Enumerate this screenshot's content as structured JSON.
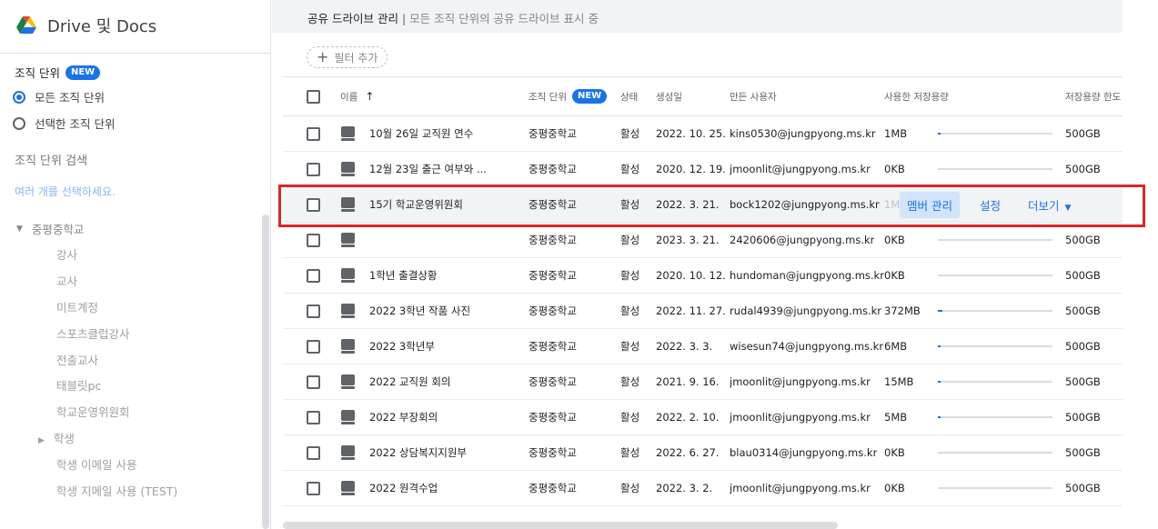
{
  "app": {
    "title": "Drive 및 Docs"
  },
  "sidebar": {
    "ou_heading": "조직 단위",
    "new_badge": "NEW",
    "options": [
      {
        "label": "모든 조직 단위",
        "selected": true
      },
      {
        "label": "선택한 조직 단위",
        "selected": false
      }
    ],
    "search_placeholder": "조직 단위 검색",
    "hint": "여러 개를 선택하세요.",
    "tree_root": "중평중학교",
    "tree_items": [
      {
        "label": "강사",
        "has_caret": false
      },
      {
        "label": "교사",
        "has_caret": false
      },
      {
        "label": "미트계정",
        "has_caret": false
      },
      {
        "label": "스포츠클럽강사",
        "has_caret": false
      },
      {
        "label": "전출교사",
        "has_caret": false
      },
      {
        "label": "태블릿pc",
        "has_caret": false
      },
      {
        "label": "학교운영위원회",
        "has_caret": false
      },
      {
        "label": "학생",
        "has_caret": true
      },
      {
        "label": "학생 이메일 사용",
        "has_caret": false
      },
      {
        "label": "학생 지메일 사용 (TEST)",
        "has_caret": false
      }
    ]
  },
  "header": {
    "title": "공유 드라이브 관리",
    "separator": "|",
    "subtitle": "모든 조직 단위의 공유 드라이브 표시 중"
  },
  "filter": {
    "label": "필터 추가"
  },
  "columns": {
    "name": "이름",
    "org_unit": "조직 단위",
    "org_unit_badge": "NEW",
    "status": "상태",
    "created": "생성일",
    "creator": "만든 사용자",
    "storage_used": "사용한 저장용량",
    "storage_limit": "저장용량 한도"
  },
  "row_actions": {
    "manage_members": "멤버 관리",
    "settings": "설정",
    "more": "더보기"
  },
  "rows": [
    {
      "name": "10월 26일 교직원 연수",
      "org": "중평중학교",
      "status": "활성",
      "created": "2022. 10. 25.",
      "creator": "kins0530@jungpyong.ms.kr",
      "used": "1MB",
      "usage": 0.02,
      "limit": "500GB"
    },
    {
      "name": "12월 23일 출근 여부와 ...",
      "org": "중평중학교",
      "status": "활성",
      "created": "2020. 12. 19.",
      "creator": "jmoonlit@jungpyong.ms.kr",
      "used": "0KB",
      "usage": 0,
      "limit": "500GB"
    },
    {
      "name": "15기 학교운영위원회",
      "org": "중평중학교",
      "status": "활성",
      "created": "2022. 3. 21.",
      "creator": "bock1202@jungpyong.ms.kr",
      "used": "1M",
      "usage": 0,
      "limit": "",
      "selected": true
    },
    {
      "name": "",
      "org": "중평중학교",
      "status": "활성",
      "created": "2023. 3. 21.",
      "creator": "2420606@jungpyong.ms.kr",
      "used": "0KB",
      "usage": 0,
      "limit": "500GB"
    },
    {
      "name": "1학년 출결상황",
      "org": "중평중학교",
      "status": "활성",
      "created": "2020. 10. 12.",
      "creator": "hundoman@jungpyong.ms.kr",
      "used": "0KB",
      "usage": 0,
      "limit": "500GB"
    },
    {
      "name": "2022 3학년 작품 사진",
      "org": "중평중학교",
      "status": "활성",
      "created": "2022. 11. 27.",
      "creator": "rudal4939@jungpyong.ms.kr",
      "used": "372MB",
      "usage": 0.04,
      "limit": "500GB"
    },
    {
      "name": "2022 3학년부",
      "org": "중평중학교",
      "status": "활성",
      "created": "2022. 3. 3.",
      "creator": "wisesun74@jungpyong.ms.kr",
      "used": "6MB",
      "usage": 0.02,
      "limit": "500GB"
    },
    {
      "name": "2022 교직원 회의",
      "org": "중평중학교",
      "status": "활성",
      "created": "2021. 9. 16.",
      "creator": "jmoonlit@jungpyong.ms.kr",
      "used": "15MB",
      "usage": 0.02,
      "limit": "500GB"
    },
    {
      "name": "2022 부장회의",
      "org": "중평중학교",
      "status": "활성",
      "created": "2022. 2. 10.",
      "creator": "jmoonlit@jungpyong.ms.kr",
      "used": "5MB",
      "usage": 0.02,
      "limit": "500GB"
    },
    {
      "name": "2022 상담복지지원부",
      "org": "중평중학교",
      "status": "활성",
      "created": "2022. 6. 27.",
      "creator": "blau0314@jungpyong.ms.kr",
      "used": "0KB",
      "usage": 0,
      "limit": "500GB"
    },
    {
      "name": "2022 원격수업",
      "org": "중평중학교",
      "status": "활성",
      "created": "2022. 3. 2.",
      "creator": "jmoonlit@jungpyong.ms.kr",
      "used": "0KB",
      "usage": 0,
      "limit": "500GB"
    }
  ],
  "colors": {
    "accent": "#1a73e8",
    "highlight": "#e02424"
  }
}
